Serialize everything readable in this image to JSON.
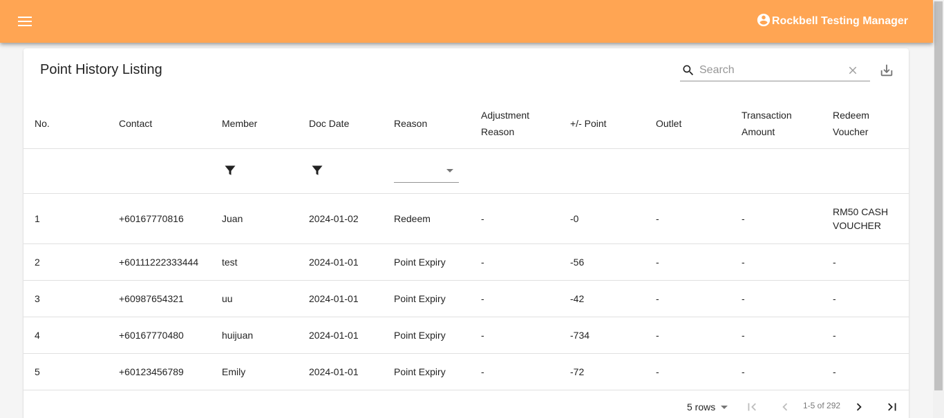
{
  "header": {
    "user_name": "Rockbell Testing Manager",
    "bg_color": "#ffa553"
  },
  "page": {
    "title": "Point History Listing",
    "search_placeholder": "Search"
  },
  "table": {
    "columns": [
      "No.",
      "Contact",
      "Member",
      "Doc Date",
      "Reason",
      "Adjustment Reason",
      "+/- Point",
      "Outlet",
      "Transaction Amount",
      "Redeem Voucher"
    ],
    "rows": [
      [
        "1",
        "+60167770816",
        "Juan",
        "2024-01-02",
        "Redeem",
        "-",
        "-0",
        "-",
        "-",
        "RM50 CASH VOUCHER"
      ],
      [
        "2",
        "+60111222333444",
        "test",
        "2024-01-01",
        "Point Expiry",
        "-",
        "-56",
        "-",
        "-",
        "-"
      ],
      [
        "3",
        "+60987654321",
        "uu",
        "2024-01-01",
        "Point Expiry",
        "-",
        "-42",
        "-",
        "-",
        "-"
      ],
      [
        "4",
        "+60167770480",
        "huijuan",
        "2024-01-01",
        "Point Expiry",
        "-",
        "-734",
        "-",
        "-",
        "-"
      ],
      [
        "5",
        "+60123456789",
        "Emily",
        "2024-01-01",
        "Point Expiry",
        "-",
        "-72",
        "-",
        "-",
        "-"
      ]
    ]
  },
  "pagination": {
    "rows_label": "5 rows",
    "range": "1-5 of 292"
  }
}
